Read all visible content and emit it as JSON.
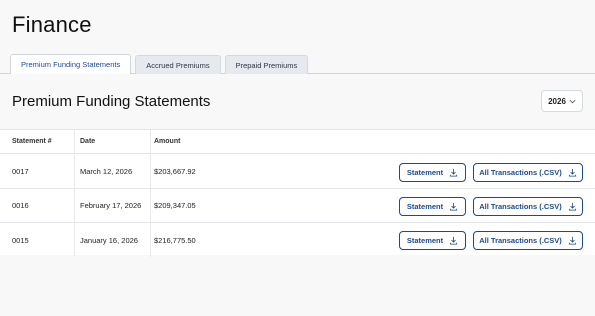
{
  "page_title": "Finance",
  "tabs": [
    {
      "label": "Premium Funding Statements",
      "active": true
    },
    {
      "label": "Accrued Premiums",
      "active": false
    },
    {
      "label": "Prepaid Premiums",
      "active": false
    }
  ],
  "section_title": "Premium Funding Statements",
  "year_filter": {
    "value": "2026",
    "icon": "chevron-down-icon"
  },
  "table": {
    "headers": [
      "Statement #",
      "Date",
      "Amount"
    ],
    "rows": [
      {
        "statement": "0017",
        "date": "March 12, 2026",
        "amount": "$203,667.92"
      },
      {
        "statement": "0016",
        "date": "February 17, 2026",
        "amount": "$209,347.05"
      },
      {
        "statement": "0015",
        "date": "January 16, 2026",
        "amount": "$216,775.50"
      }
    ],
    "statement_button_label": "Statement",
    "csv_button_label": "All Transactions (.CSV)",
    "download_icon": "download-icon"
  },
  "colors": {
    "accent": "#1c4a8c",
    "background": "#f8f8f8",
    "tab_inactive": "#e6eaee"
  }
}
